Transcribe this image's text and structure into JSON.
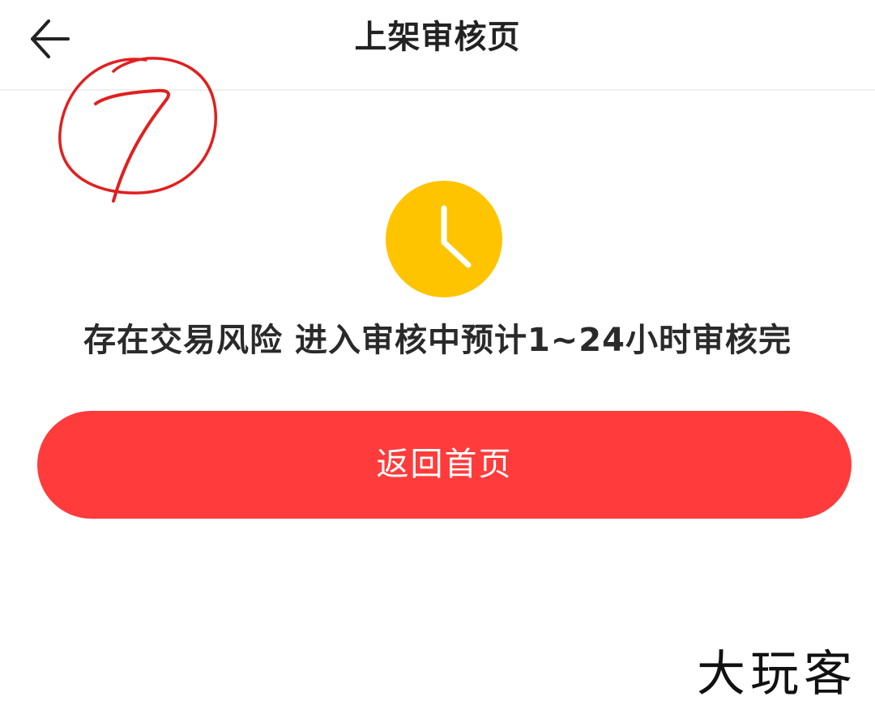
{
  "header": {
    "title": "上架审核页",
    "back_icon": "arrow-left-icon"
  },
  "annotation": {
    "text": "7",
    "color": "#e02020"
  },
  "status": {
    "icon": "clock-icon",
    "icon_color": "#ffc400",
    "message": "存在交易风险 进入审核中预计1~24小时审核完"
  },
  "actions": {
    "home_label": "返回首页",
    "home_color": "#ff3b3b"
  },
  "watermark": {
    "text": "大玩客"
  }
}
